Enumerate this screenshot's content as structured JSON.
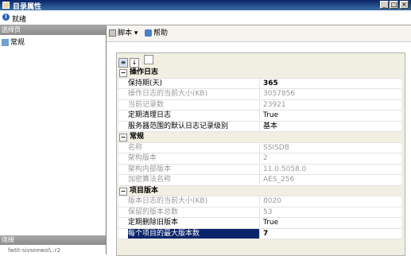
{
  "window": {
    "title": "目录属性"
  },
  "status": {
    "text": "就绪"
  },
  "left": {
    "header": "选择页",
    "items": [
      {
        "label": "常规"
      }
    ],
    "connection_header": "连接",
    "connection_text": "fwtit-sivseewol\\..r2"
  },
  "toolbar": {
    "script_label": "脚本",
    "help_label": "帮助"
  },
  "grid": {
    "categories": [
      {
        "label": "操作日志",
        "rows": [
          {
            "name": "保持期(天)",
            "value": "365",
            "gray": false
          },
          {
            "name": "操作日志的当前大小(KB)",
            "value": "3057856",
            "gray": true
          },
          {
            "name": "当前记录数",
            "value": "23921",
            "gray": true
          },
          {
            "name": "定期清理日志",
            "value": "True",
            "gray": false
          },
          {
            "name": "服务器范围的默认日志记录级别",
            "value": "基本",
            "gray": false
          }
        ]
      },
      {
        "label": "常规",
        "rows": [
          {
            "name": "名称",
            "value": "SSISDB",
            "gray": true
          },
          {
            "name": "架构版本",
            "value": "2",
            "gray": true
          },
          {
            "name": "架构内部版本",
            "value": "11.0.5058.0",
            "gray": true
          },
          {
            "name": "加密算法名称",
            "value": "AES_256",
            "gray": true
          }
        ]
      },
      {
        "label": "项目版本",
        "rows": [
          {
            "name": "版本日志的当前大小(KB)",
            "value": "8020",
            "gray": true
          },
          {
            "name": "保留的版本总数",
            "value": "53",
            "gray": true
          },
          {
            "name": "定期删除旧版本",
            "value": "True",
            "gray": false
          },
          {
            "name": "每个项目的最大版本数",
            "value": "7",
            "gray": false,
            "selected": true
          }
        ]
      }
    ]
  }
}
